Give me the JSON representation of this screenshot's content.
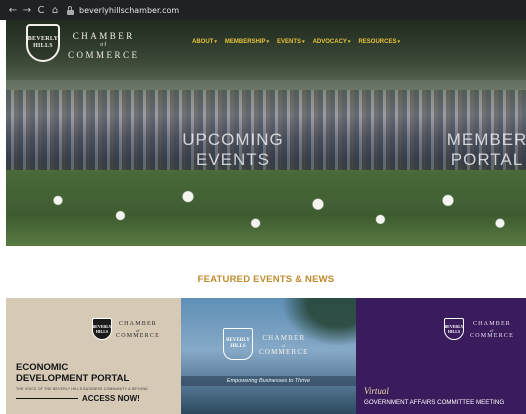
{
  "browser": {
    "back_icon": "←",
    "forward_icon": "→",
    "reload_icon": "C",
    "home_icon": "⌂",
    "url": "beverlyhillschamber.com"
  },
  "site": {
    "logo": {
      "shield_lines": [
        "BEVERLY",
        "HILLS"
      ],
      "name_line1": "CHAMBER",
      "name_of": "of",
      "name_line2": "COMMERCE"
    },
    "menu": [
      {
        "label": "ABOUT"
      },
      {
        "label": "MEMBERSHIP"
      },
      {
        "label": "EVENTS"
      },
      {
        "label": "ADVOCACY"
      },
      {
        "label": "RESOURCES"
      }
    ],
    "menu_caret": "▾",
    "hero": {
      "events_label": "UPCOMING EVENTS",
      "portal_label": "MEMBER PORTAL"
    },
    "featured_heading": "FEATURED EVENTS & NEWS",
    "cards": [
      {
        "shield_lines": [
          "BEVERLY",
          "HILLS"
        ],
        "name_line1": "CHAMBER",
        "name_of": "of",
        "name_line2": "COMMERCE",
        "title_line1": "ECONOMIC",
        "title_line2": "DEVELOPMENT PORTAL",
        "subtitle": "THE VOICE OF THE BEVERLY HILLS BUSINESS COMMUNITY & BEYOND",
        "cta": "ACCESS NOW!"
      },
      {
        "shield_lines": [
          "BEVERLY",
          "HILLS"
        ],
        "name_line1": "CHAMBER",
        "name_of": "of",
        "name_line2": "COMMERCE",
        "tagline": "Empowering Businesses to Thrive"
      },
      {
        "shield_lines": [
          "BEVERLY",
          "HILLS"
        ],
        "name_line1": "CHAMBER",
        "name_of": "of",
        "name_line2": "COMMERCE",
        "virtual": "Virtual",
        "title": "GOVERNMENT AFFAIRS COMMITTEE MEETING"
      }
    ]
  },
  "colors": {
    "menu_gold": "#e5c23a",
    "heading_gold": "#c08a2e",
    "card3_purple": "#3a1b5c"
  }
}
